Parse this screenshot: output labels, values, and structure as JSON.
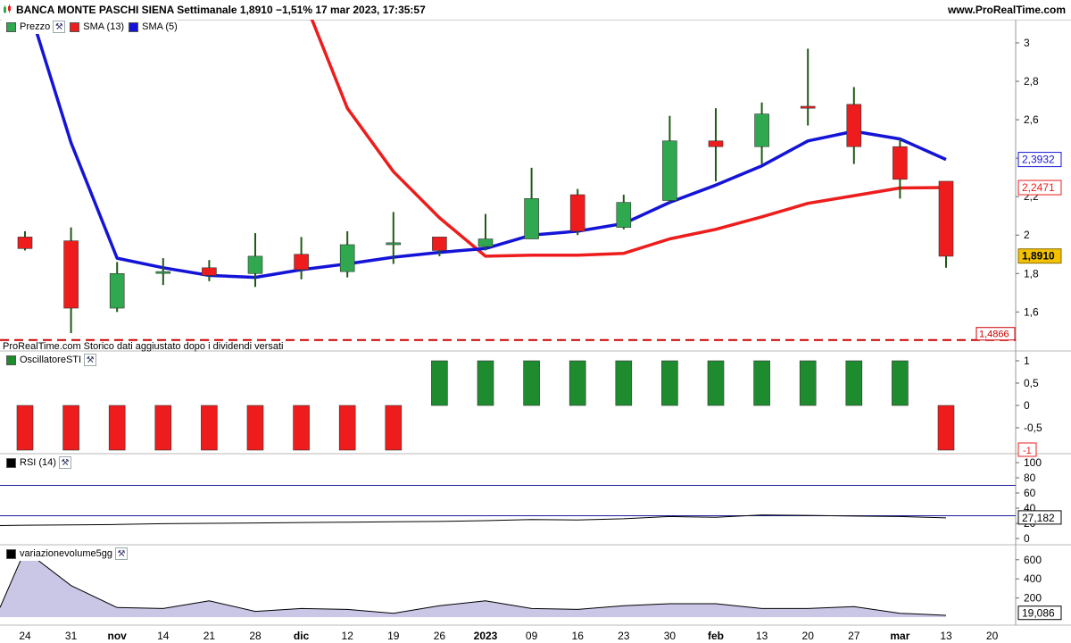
{
  "header": {
    "title": "BANCA MONTE PASCHI SIENA Settimanale 1,8910 −1,51% 17 mar 2023, 17:35:57",
    "site": "www.ProRealTime.com"
  },
  "legend": {
    "price_label": "Prezzo",
    "sma13_label": "SMA (13)",
    "sma5_label": "SMA (5)",
    "osc_label": "OscillatoreSTI",
    "rsi_label": "RSI (14)",
    "vol_label": "variazionevolume5gg",
    "wrench_icon": "wrench-icon"
  },
  "note": "ProRealTime.com  Storico dati aggiustato dopo i dividendi versati",
  "colors": {
    "up": "#2fa84f",
    "down": "#ee1c1c",
    "sma13": "#ee1c1c",
    "sma5": "#1414d8",
    "osc_up": "#1e8c2e",
    "osc_down": "#ee1c1c",
    "rsi": "#000000",
    "volume_fill": "#c9c6e6"
  },
  "chart_data": [
    {
      "type": "candlestick",
      "title": "Prezzo",
      "ylim": [
        1.49,
        3.1
      ],
      "yticks": [
        "1,6",
        "1,8",
        "2",
        "2,2",
        "2,4",
        "2,6",
        "2,8",
        "3"
      ],
      "x_tick_labels": [
        "24",
        "31",
        "nov",
        "14",
        "21",
        "28",
        "dic",
        "12",
        "19",
        "26",
        "2023",
        "09",
        "16",
        "23",
        "30",
        "feb",
        "13",
        "20",
        "27",
        "mar",
        "13",
        "20"
      ],
      "candles": [
        {
          "o": 1.99,
          "h": 2.02,
          "l": 1.92,
          "c": 1.93
        },
        {
          "o": 1.97,
          "h": 2.04,
          "l": 1.49,
          "c": 1.62
        },
        {
          "o": 1.62,
          "h": 1.86,
          "l": 1.6,
          "c": 1.8
        },
        {
          "o": 1.81,
          "h": 1.88,
          "l": 1.74,
          "c": 1.81
        },
        {
          "o": 1.83,
          "h": 1.87,
          "l": 1.76,
          "c": 1.79
        },
        {
          "o": 1.8,
          "h": 2.01,
          "l": 1.73,
          "c": 1.89
        },
        {
          "o": 1.9,
          "h": 1.99,
          "l": 1.77,
          "c": 1.82
        },
        {
          "o": 1.81,
          "h": 2.02,
          "l": 1.78,
          "c": 1.95
        },
        {
          "o": 1.95,
          "h": 2.12,
          "l": 1.85,
          "c": 1.96
        },
        {
          "o": 1.99,
          "h": 1.99,
          "l": 1.89,
          "c": 1.92
        },
        {
          "o": 1.94,
          "h": 2.11,
          "l": 1.92,
          "c": 1.98
        },
        {
          "o": 1.98,
          "h": 2.35,
          "l": 1.98,
          "c": 2.19
        },
        {
          "o": 2.21,
          "h": 2.24,
          "l": 2.0,
          "c": 2.02
        },
        {
          "o": 2.04,
          "h": 2.21,
          "l": 2.03,
          "c": 2.17
        },
        {
          "o": 2.18,
          "h": 2.62,
          "l": 2.17,
          "c": 2.49
        },
        {
          "o": 2.49,
          "h": 2.66,
          "l": 2.28,
          "c": 2.46
        },
        {
          "o": 2.46,
          "h": 2.69,
          "l": 2.37,
          "c": 2.63
        },
        {
          "o": 2.67,
          "h": 2.97,
          "l": 2.57,
          "c": 2.66
        },
        {
          "o": 2.68,
          "h": 2.77,
          "l": 2.37,
          "c": 2.46
        },
        {
          "o": 2.46,
          "h": 2.5,
          "l": 2.19,
          "c": 2.29
        },
        {
          "o": 2.28,
          "h": 2.28,
          "l": 1.83,
          "c": 1.89
        }
      ],
      "series": [
        {
          "name": "SMA (13)",
          "values": [
            null,
            null,
            null,
            null,
            null,
            null,
            3.35,
            2.66,
            2.33,
            2.09,
            1.89,
            1.895,
            1.895,
            1.905,
            1.98,
            2.03,
            2.095,
            2.165,
            2.205,
            2.245,
            2.2471
          ]
        },
        {
          "name": "SMA (5)",
          "values": [
            3.25,
            2.48,
            1.88,
            1.83,
            1.79,
            1.78,
            1.82,
            1.85,
            1.885,
            1.91,
            1.93,
            2.0,
            2.02,
            2.06,
            2.17,
            2.26,
            2.36,
            2.49,
            2.54,
            2.5,
            2.3932
          ]
        }
      ],
      "reference_line": {
        "value": 1.4866,
        "label": "1,4866"
      },
      "value_labels": [
        {
          "text": "2,3932",
          "value": 2.3932,
          "role": "sma5"
        },
        {
          "text": "2,2471",
          "value": 2.2471,
          "role": "sma13"
        },
        {
          "text": "1,8910",
          "value": 1.891,
          "role": "price"
        }
      ]
    },
    {
      "type": "bar",
      "title": "OscillatoreSTI",
      "ylim": [
        -1,
        1
      ],
      "yticks": [
        "1",
        "0,5",
        "0",
        "-0,5"
      ],
      "last_label": "-1",
      "values": [
        -1,
        -1,
        -1,
        -1,
        -1,
        -1,
        -1,
        -1,
        -1,
        1,
        1,
        1,
        1,
        1,
        1,
        1,
        1,
        1,
        1,
        1,
        -1
      ]
    },
    {
      "type": "line",
      "title": "RSI (14)",
      "ylim": [
        0,
        100
      ],
      "yticks": [
        "100",
        "80",
        "60",
        "40",
        "20",
        "0"
      ],
      "levels": [
        70,
        30
      ],
      "values": [
        17.5,
        18,
        18.5,
        19.5,
        20,
        20.5,
        21,
        21.5,
        22,
        22.5,
        23.5,
        25,
        24.5,
        26,
        29,
        28,
        31,
        30.5,
        29.5,
        29,
        27.182
      ],
      "last_label": "27,182"
    },
    {
      "type": "area",
      "title": "variazionevolume5gg",
      "ylim": [
        0,
        720
      ],
      "yticks": [
        "600",
        "400",
        "200"
      ],
      "x_lead": [
        20,
        100
      ],
      "values": [
        700,
        330,
        100,
        90,
        170,
        60,
        90,
        80,
        40,
        120,
        170,
        90,
        80,
        120,
        140,
        140,
        90,
        90,
        110,
        40,
        19.086
      ],
      "last_label": "19,086"
    }
  ]
}
